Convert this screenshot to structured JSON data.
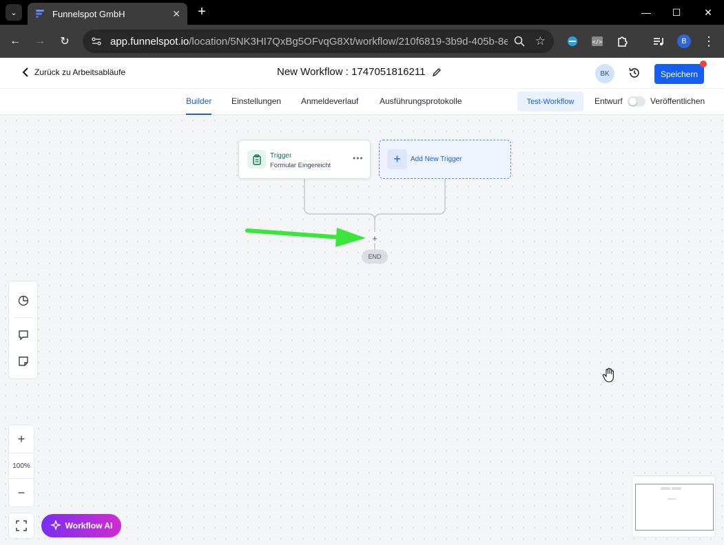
{
  "browser": {
    "tab_title": "Funnelspot GmbH",
    "url_host": "app.funnelspot.io",
    "url_path": "/location/5NK3HI7QxBg5OFvqG8Xt/workflow/210f6819-3b9d-405b-8eb5...",
    "profile_initial": "B"
  },
  "header": {
    "back_label": "Zurück zu Arbeitsabläufe",
    "workflow_title": "New Workflow : 1747051816211",
    "avatar_initials": "BK",
    "save_label": "Speichern"
  },
  "subnav": {
    "tabs": [
      {
        "label": "Builder",
        "active": true
      },
      {
        "label": "Einstellungen"
      },
      {
        "label": "Anmeldeverlauf"
      },
      {
        "label": "Ausführungsprotokolle"
      }
    ],
    "test_label": "Test-Workflow",
    "draft_label": "Entwurf",
    "publish_label": "Veröffentlichen"
  },
  "canvas": {
    "trigger_title": "Trigger",
    "trigger_subtitle": "Formular Eingereicht",
    "add_trigger_label": "Add New Trigger",
    "end_label": "END",
    "zoom_level": "100%",
    "ai_label": "Workflow AI"
  },
  "colors": {
    "accent": "#155eef",
    "trigger_green": "#067647",
    "annotation_arrow": "#39e639"
  }
}
